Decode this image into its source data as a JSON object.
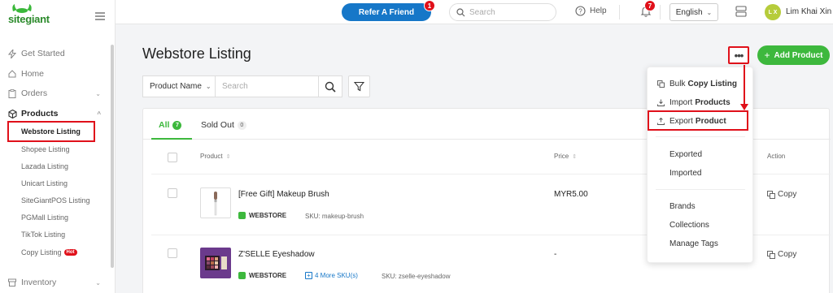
{
  "brand": {
    "name": "sitegiant"
  },
  "sidebar": {
    "items": [
      {
        "label": "Get Started",
        "icon": "bolt-icon"
      },
      {
        "label": "Home",
        "icon": "home-icon"
      },
      {
        "label": "Orders",
        "icon": "clipboard-icon"
      },
      {
        "label": "Products",
        "icon": "box-icon"
      },
      {
        "label": "Inventory",
        "icon": "archive-icon"
      }
    ],
    "products_sub": [
      {
        "label": "Webstore Listing"
      },
      {
        "label": "Shopee Listing"
      },
      {
        "label": "Lazada Listing"
      },
      {
        "label": "Unicart Listing"
      },
      {
        "label": "SiteGiantPOS Listing"
      },
      {
        "label": "PGMall Listing"
      },
      {
        "label": "TikTok Listing"
      },
      {
        "label": "Copy Listing"
      }
    ],
    "hot_badge": "Hot"
  },
  "topbar": {
    "refer_label": "Refer A Friend",
    "refer_badge": "1",
    "search_placeholder": "Search",
    "help_label": "Help",
    "notif_count": "7",
    "language": "English",
    "avatar_initials": "L X",
    "user_name": "Lim Khai Xin"
  },
  "page": {
    "title": "Webstore Listing",
    "add_button": "Add Product",
    "filter_select": "Product Name",
    "search_placeholder": "Search"
  },
  "tabs": [
    {
      "label": "All",
      "count": "7"
    },
    {
      "label": "Sold Out",
      "count": "0"
    }
  ],
  "table": {
    "headers": {
      "product": "Product",
      "price": "Price",
      "action": "Action"
    },
    "rows": [
      {
        "name": "[Free Gift] Makeup Brush",
        "channel": "WEBSTORE",
        "sku": "SKU: makeup-brush",
        "price": "MYR5.00",
        "action": "Copy",
        "more_sku": ""
      },
      {
        "name": "Z'SELLE Eyeshadow",
        "channel": "WEBSTORE",
        "sku": "SKU: zselle-eyeshadow",
        "price": "-",
        "action": "Copy",
        "more_sku": "4 More SKU(s)"
      }
    ]
  },
  "menu": {
    "bulk_copy": {
      "pre": "Bulk",
      "bold": "Copy Listing"
    },
    "import_products": {
      "pre": "Import",
      "bold": "Products"
    },
    "export_product": {
      "pre": "Export",
      "bold": "Product"
    },
    "exported": "Exported",
    "imported": "Imported",
    "brands": "Brands",
    "collections": "Collections",
    "manage_tags": "Manage Tags"
  },
  "colors": {
    "accent": "#3db83d",
    "primary": "#1677c8",
    "highlight": "#e0101a"
  }
}
